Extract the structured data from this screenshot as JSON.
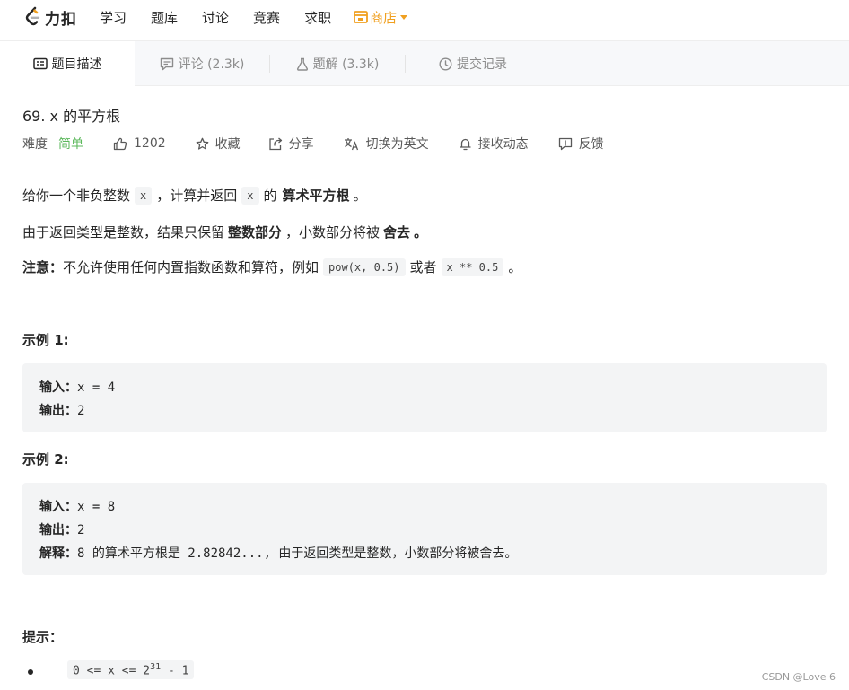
{
  "nav": {
    "logo_text": "力扣",
    "items": [
      "学习",
      "题库",
      "讨论",
      "竞赛",
      "求职"
    ],
    "store": "商店",
    "brand_color": "#f0a020"
  },
  "tabs": [
    {
      "label": "题目描述",
      "icon": "description-icon",
      "active": true
    },
    {
      "label": "评论 (2.3k)",
      "icon": "comment-icon",
      "active": false
    },
    {
      "label": "题解 (3.3k)",
      "icon": "flask-icon",
      "active": false
    },
    {
      "label": "提交记录",
      "icon": "clock-icon",
      "active": false
    }
  ],
  "problem": {
    "title": "69. x 的平方根",
    "difficulty_label": "难度",
    "difficulty": "简单",
    "likes": "1202",
    "favorite": "收藏",
    "share": "分享",
    "translate": "切换为英文",
    "subscribe": "接收动态",
    "feedback": "反馈"
  },
  "description": {
    "p1": {
      "pre": "给你一个非负整数",
      "code1": "x",
      "mid": "，计算并返回",
      "code2": "x",
      "of": "的",
      "bold": "算术平方根",
      "end": "。"
    },
    "p2": {
      "pre": "由于返回类型是整数，结果只保留",
      "bold1": "整数部分",
      "mid": "，小数部分将被",
      "bold2": "舍去",
      "end": "。"
    },
    "p3": {
      "bold": "注意：",
      "text": "不允许使用任何内置指数函数和算符，例如",
      "code1": "pow(x, 0.5)",
      "or": "或者",
      "code2": "x ** 0.5",
      "end": "。"
    }
  },
  "examples": [
    {
      "title": "示例 1:",
      "input_label": "输入：",
      "input": "x = 4",
      "output_label": "输出：",
      "output": "2"
    },
    {
      "title": "示例 2:",
      "input_label": "输入：",
      "input": "x = 8",
      "output_label": "输出：",
      "output": "2",
      "explain_label": "解释：",
      "explain": "8 的算术平方根是 2.82842..., 由于返回类型是整数，小数部分将被舍去。"
    }
  ],
  "hints": {
    "title": "提示：",
    "item_pre": "0 <= x <= 2",
    "item_sup": "31",
    "item_post": " - 1"
  },
  "watermark": "CSDN @Love 6"
}
